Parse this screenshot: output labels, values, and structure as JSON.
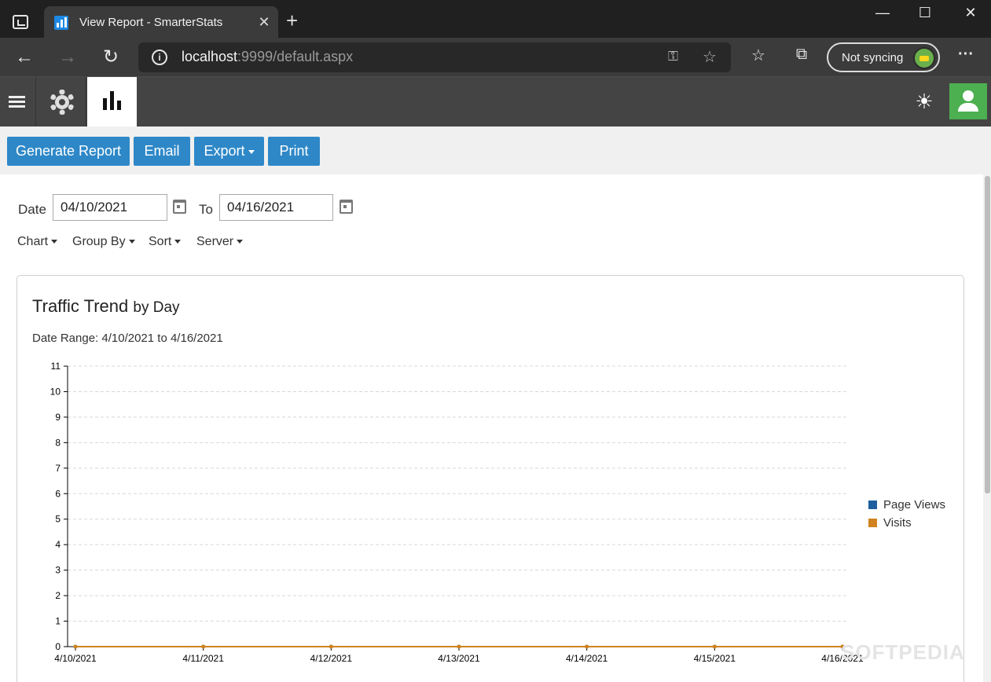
{
  "browser": {
    "tab_title": "View Report - SmarterStats",
    "tab_close": "✕",
    "new_tab": "+",
    "url_host": "localhost",
    "url_rest": ":9999/default.aspx",
    "sync_label": "Not syncing",
    "window_controls": [
      "—",
      "☐",
      "✕"
    ]
  },
  "toolbar": {
    "generate_label": "Generate Report",
    "email_label": "Email",
    "export_label": "Export",
    "print_label": "Print"
  },
  "filters": {
    "date_label": "Date",
    "date_from": "04/10/2021",
    "to_label": "To",
    "date_to": "04/16/2021",
    "chart_label": "Chart",
    "groupby_label": "Group By",
    "sort_label": "Sort",
    "server_label": "Server"
  },
  "report": {
    "title": "Traffic Trend",
    "title_suffix": "by Day",
    "date_range": "Date Range: 4/10/2021 to 4/16/2021"
  },
  "watermark": "SOFTPEDIA",
  "chart_data": {
    "type": "line",
    "x": [
      "4/10/2021",
      "4/11/2021",
      "4/12/2021",
      "4/13/2021",
      "4/14/2021",
      "4/15/2021",
      "4/16/2021"
    ],
    "series": [
      {
        "name": "Page Views",
        "values": [
          0,
          0,
          0,
          0,
          0,
          0,
          0
        ],
        "color": "#1f5f9e"
      },
      {
        "name": "Visits",
        "values": [
          0,
          0,
          0,
          0,
          0,
          0,
          0
        ],
        "color": "#d0831f"
      }
    ],
    "ylim": [
      0,
      11
    ],
    "yticks": [
      0,
      1,
      2,
      3,
      4,
      5,
      6,
      7,
      8,
      9,
      10,
      11
    ],
    "grid": true,
    "legend": "right"
  }
}
